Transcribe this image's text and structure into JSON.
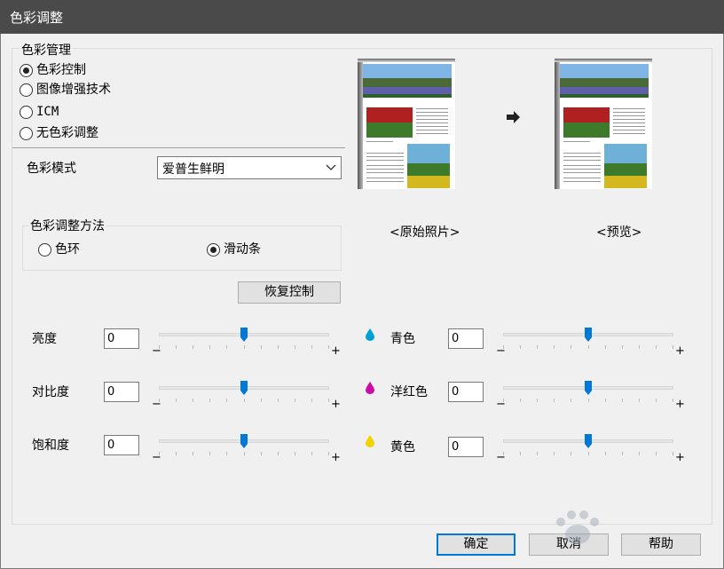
{
  "window": {
    "title": "色彩调整"
  },
  "color_management": {
    "legend": "色彩管理",
    "options": [
      {
        "label": "色彩控制",
        "selected": true
      },
      {
        "label": "图像增强技术",
        "selected": false
      },
      {
        "label": "ICM",
        "selected": false
      },
      {
        "label": "无色彩调整",
        "selected": false
      }
    ]
  },
  "color_mode": {
    "label": "色彩模式",
    "value": "爱普生鲜明"
  },
  "adjust_method": {
    "legend": "色彩调整方法",
    "options": [
      {
        "label": "色环",
        "selected": false
      },
      {
        "label": "滑动条",
        "selected": true
      }
    ]
  },
  "restore_button": "恢复控制",
  "preview": {
    "original_label": "<原始照片>",
    "preview_label": "<预览>"
  },
  "left_sliders": [
    {
      "label": "亮度",
      "value": "0",
      "level": 0.5
    },
    {
      "label": "对比度",
      "value": "0",
      "level": 0.5
    },
    {
      "label": "饱和度",
      "value": "0",
      "level": 0.5
    }
  ],
  "right_sliders": [
    {
      "label": "青色",
      "value": "0",
      "level": 0.5,
      "drop_color": "#00a0d6"
    },
    {
      "label": "洋红色",
      "value": "0",
      "level": 0.5,
      "drop_color": "#cc0aa8"
    },
    {
      "label": "黄色",
      "value": "0",
      "level": 0.5,
      "drop_color": "#f0d400"
    }
  ],
  "slider_signs": {
    "minus": "−",
    "plus": "+"
  },
  "footer": {
    "ok": "确定",
    "cancel": "取消",
    "help": "帮助"
  },
  "accent_color": "#0078d7"
}
